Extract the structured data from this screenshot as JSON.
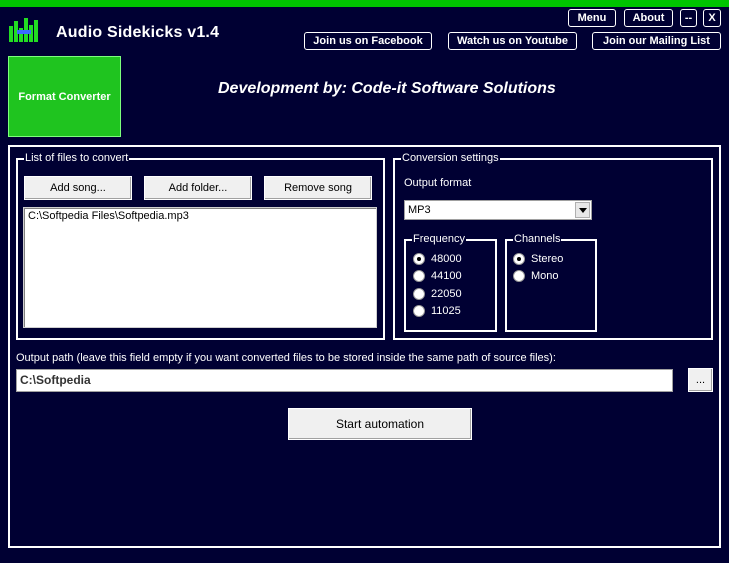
{
  "app": {
    "title": "Audio Sidekicks v1.4",
    "logo_icon": "equalizer-icon"
  },
  "header": {
    "menu_label": "Menu",
    "about_label": "About",
    "minimize_label": "--",
    "close_label": "X",
    "links": [
      "Join us on Facebook",
      "Watch us on Youtube",
      "Join our Mailing List"
    ]
  },
  "tile": {
    "label": "Format Converter"
  },
  "developer": "Development by: Code-it Software Solutions",
  "files": {
    "legend": "List of files to convert",
    "add_song": "Add song...",
    "add_folder": "Add folder...",
    "remove_song": "Remove song",
    "items": [
      "C:\\Softpedia Files\\Softpedia.mp3"
    ]
  },
  "settings": {
    "legend": "Conversion settings",
    "output_format_label": "Output format",
    "output_format_value": "MP3",
    "frequency": {
      "legend": "Frequency",
      "options": [
        "48000",
        "44100",
        "22050",
        "11025"
      ],
      "selected": "48000"
    },
    "channels": {
      "legend": "Channels",
      "options": [
        "Stereo",
        "Mono"
      ],
      "selected": "Stereo"
    }
  },
  "output": {
    "label": "Output path (leave this field empty if you want converted files to be stored inside the same path of source files):",
    "value": "C:\\Softpedia",
    "browse_label": "..."
  },
  "start_label": "Start automation",
  "colors": {
    "background": "#000033",
    "accent": "#1fc41f",
    "topbar": "#00c400"
  }
}
